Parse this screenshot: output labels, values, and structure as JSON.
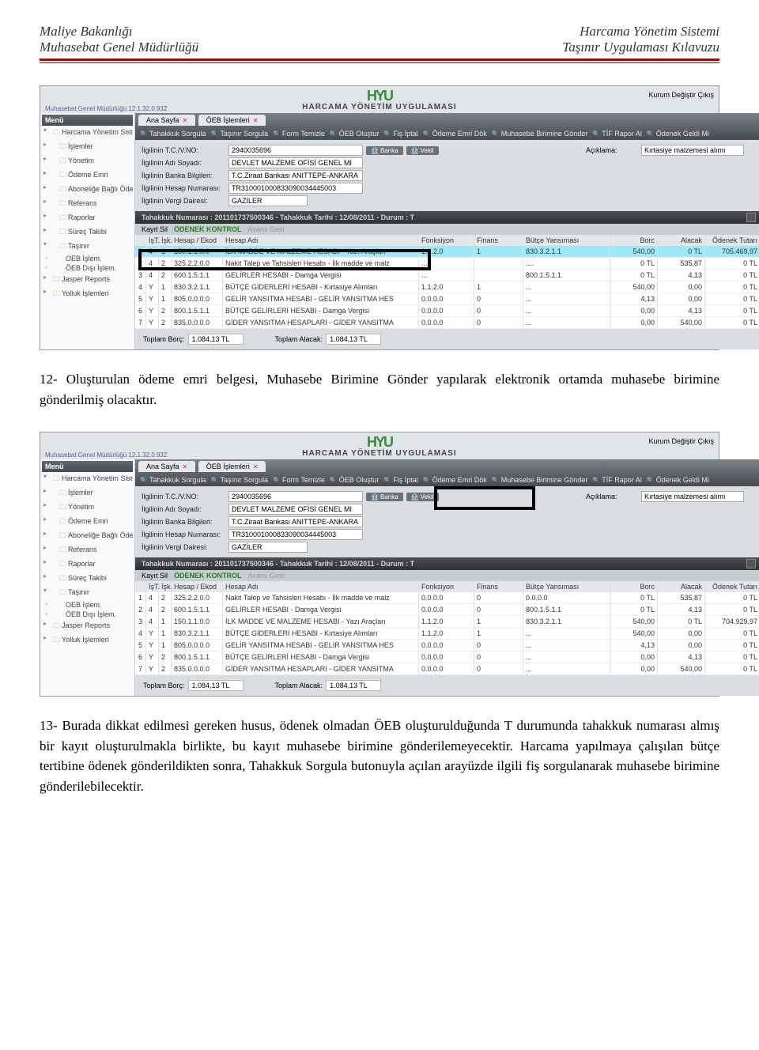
{
  "header": {
    "left1": "Maliye Bakanlığı",
    "left2": "Muhasebat Genel Müdürlüğü",
    "right1": "Harcama Yönetim Sistemi",
    "right2": "Taşınır Uygulaması Kılavuzu"
  },
  "app": {
    "version": "Muhasebat Genel Müdürlüğü 12.1.32.0.932",
    "top_btns": {
      "kurum": "Kurum Değiştir",
      "cikis": "Çıkış"
    },
    "logo": {
      "title": "HYU",
      "subtitle": "HARCAMA YÖNETİM UYGULAMASI"
    },
    "menu_header": "Menü",
    "tree": [
      "Harcama Yönetim Sister",
      "İşlemler",
      "Yönetim",
      "Ödeme Emri",
      "Aboneliğe Bağlı Öder",
      "Referans",
      "Raporlar",
      "Süreç Takibi",
      "Taşınır",
      "OEB İşlem.",
      "ÖEB Dışı İşlem.",
      "Jasper Reports",
      "Yolluk İşlemleri"
    ],
    "tabs": [
      "Ana Sayfa",
      "ÖEB İşlemleri"
    ],
    "toolbar": [
      "Tahakkuk Sorgula",
      "Taşınır Sorgula",
      "Form Temizle",
      "ÖEB Oluştur",
      "Fiş İptal",
      "Ödeme Emri Dök",
      "Muhasebe Birimine Gönder",
      "TİF Rapor Al",
      "Ödenek Geldi Mi"
    ],
    "form": {
      "tc_label": "İlgilinin T.C./V.NO:",
      "tc_value": "2940035696",
      "banka_btn": "Banka",
      "vekil_btn": "Vekil",
      "aciklama_label": "Açıklama:",
      "aciklama_value": "Kırtasiye malzemesi alımı",
      "ad_label": "İlgilinin Adı Soyadı:",
      "ad_value": "DEVLET MALZEME OFİSİ GENEL MI",
      "bb_label": "İlgilinin Banka Bilgileri:",
      "bb_value": "T.C.Ziraat Bankası ANITTEPE-ANKARA",
      "hn_label": "İlgilinin Hesap Numarası:",
      "hn_value": "TR310001000833090034445003",
      "vd_label": "İlgilinin Vergi Dairesi:",
      "vd_value": "GAZİLER"
    },
    "tahakkuk_bar": "Tahakkuk Numarası : 201101737500346 - Tahakkuk Tarihi : 12/08/2011 - Durum : T",
    "kayit": {
      "sil": "Kayıt Sil",
      "ok": "ÖDENEK KONTROL",
      "ag": "Avans Getir"
    },
    "thead": [
      "",
      "İşT.",
      "İşk.",
      "Hesap / Ekod",
      "Hesap Adı",
      "Fonksiyon",
      "Finans",
      "Bütçe Yansıması",
      "Borc",
      "Alacak",
      "Ödenek Tutarı"
    ],
    "rows1": [
      [
        "1",
        "4",
        "1",
        "150.1.1.0.0",
        "İLK MADDE VE MALZEME HESABI - Yazı Araçları",
        "1.1.2.0",
        "1",
        "830.3.2.1.1",
        "540,00",
        "0 TL",
        "705.469,97"
      ],
      [
        "2",
        "4",
        "2",
        "325.2.2.0.0",
        "Nakit Talep ve Tahsisleri Hesabı - İlk madde ve malz",
        "...",
        "",
        "....",
        "0 TL",
        "535,87",
        "0 TL"
      ],
      [
        "3",
        "4",
        "2",
        "600.1.5.1.1",
        "GELİRLER HESABI - Damga Vergisi",
        "...",
        "",
        "800.1.5.1.1",
        "0 TL",
        "4,13",
        "0 TL"
      ],
      [
        "4",
        "Y",
        "1",
        "830.3.2.1.1",
        "BÜTÇE GİDERLERİ HESABI - Kırtasiye Alımları",
        "1.1.2.0",
        "1",
        "...",
        "540,00",
        "0,00",
        "0 TL"
      ],
      [
        "5",
        "Y",
        "1",
        "805.0.0.0.0",
        "GELİR YANSITMA HESABI - GELİR YANSITMA HES",
        "0.0.0.0",
        "0",
        "...",
        "4,13",
        "0,00",
        "0 TL"
      ],
      [
        "6",
        "Y",
        "2",
        "800.1.5.1.1",
        "BÜTÇE GELİRLERİ HESABI - Damga Vergisi",
        "0.0.0.0",
        "0",
        "...",
        "0,00",
        "4,13",
        "0 TL"
      ],
      [
        "7",
        "Y",
        "2",
        "835.0.0.0.0",
        "GİDER YANSITMA HESAPLARI - GİDER YANSITMA",
        "0.0.0.0",
        "0",
        "...",
        "0,00",
        "540,00",
        "0 TL"
      ]
    ],
    "rows2": [
      [
        "1",
        "4",
        "2",
        "325.2.2.0.0",
        "Nakit Talep ve Tahsisleri Hesabı - İlk madde ve malz",
        "0.0.0.0",
        "0",
        "0.0.0.0",
        "0 TL",
        "535,87",
        "0 TL"
      ],
      [
        "2",
        "4",
        "2",
        "600.1.5.1.1",
        "GELİRLER HESABI - Damga Vergisi",
        "0.0.0.0",
        "0",
        "800.1.5.1.1",
        "0 TL",
        "4,13",
        "0 TL"
      ],
      [
        "3",
        "4",
        "1",
        "150.1.1.0.0",
        "İLK MADDE VE MALZEME HESABI - Yazı Araçları",
        "1.1.2.0",
        "1",
        "830.3.2.1.1",
        "540,00",
        "0 TL",
        "704.929,97"
      ],
      [
        "4",
        "Y",
        "1",
        "830.3.2.1.1",
        "BÜTÇE GİDERLERİ HESABI - Kırtasiye Alımları",
        "1.1.2.0",
        "1",
        "...",
        "540,00",
        "0,00",
        "0 TL"
      ],
      [
        "5",
        "Y",
        "1",
        "805.0.0.0.0",
        "GELİR YANSITMA HESABI - GELİR YANSITMA HES",
        "0.0.0.0",
        "0",
        "...",
        "4,13",
        "0,00",
        "0 TL"
      ],
      [
        "6",
        "Y",
        "2",
        "800.1.5.1.1",
        "BÜTÇE GELİRLERİ HESABI - Damga Vergisi",
        "0.0.0.0",
        "0",
        "...",
        "0,00",
        "4,13",
        "0 TL"
      ],
      [
        "7",
        "Y",
        "2",
        "835.0.0.0.0",
        "GİDER YANSITMA HESAPLARI - GİDER YANSITMA",
        "0.0.0.0",
        "0",
        "...",
        "0,00",
        "540,00",
        "0 TL"
      ]
    ],
    "totals": {
      "b_label": "Toplam Borç:",
      "b_val": "1.084,13 TL",
      "a_label": "Toplam Alacak:",
      "a_val": "1.084,13 TL"
    }
  },
  "para1": "12- Oluşturulan ödeme emri belgesi, Muhasebe Birimine Gönder yapılarak elektronik ortamda muhasebe birimine gönderilmiş olacaktır.",
  "para2": "13- Burada dikkat edilmesi gereken husus, ödenek olmadan ÖEB oluşturulduğunda T durumunda tahakkuk numarası almış bir kayıt oluşturulmakla birlikte, bu kayıt muhasebe birimine gönderilemeyecektir. Harcama yapılmaya çalışılan bütçe tertibine ödenek gönderildikten sonra,     Tahakkuk Sorgula butonuyla açılan arayüzde ilgili fiş sorgulanarak muhasebe birimine gönderilebilecektir."
}
